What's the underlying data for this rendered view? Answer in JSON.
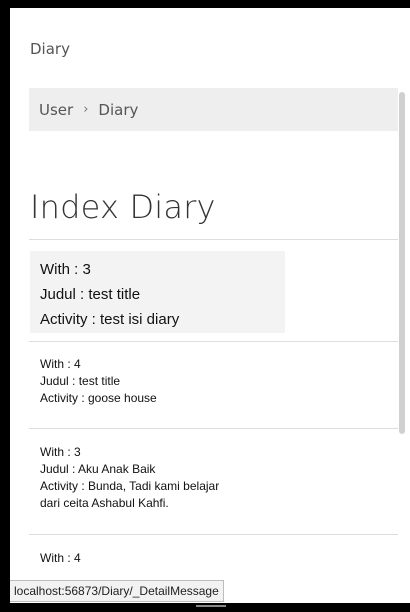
{
  "app": {
    "title": "Diary"
  },
  "breadcrumb": {
    "items": [
      "User",
      "Diary"
    ],
    "separator": "›"
  },
  "page": {
    "title": "Index Diary"
  },
  "featured": {
    "with": "With : 3",
    "judul": "Judul : test title",
    "activity": "Activity : test isi diary"
  },
  "entries": [
    {
      "with": "With : 4",
      "judul": "Judul : test title",
      "activity": "Activity : goose house"
    },
    {
      "with": "With : 3",
      "judul": "Judul : Aku Anak Baik",
      "activity": "Activity : Bunda, Tadi kami belajar",
      "activity_cont": "dari ceita Ashabul Kahfi."
    },
    {
      "with": "With : 4"
    }
  ],
  "status": {
    "url": "localhost:56873/Diary/_DetailMessage"
  }
}
